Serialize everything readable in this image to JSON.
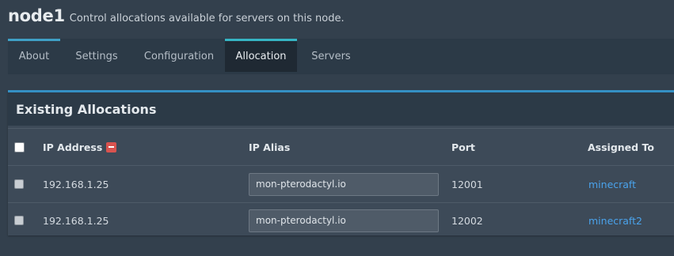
{
  "header": {
    "title": "node1",
    "subtitle": "Control allocations available for servers on this node."
  },
  "tabs": [
    {
      "label": "About"
    },
    {
      "label": "Settings"
    },
    {
      "label": "Configuration"
    },
    {
      "label": "Allocation",
      "active": true
    },
    {
      "label": "Servers"
    }
  ],
  "panel": {
    "title": "Existing Allocations",
    "columns": {
      "ip_address": "IP Address",
      "ip_alias": "IP Alias",
      "port": "Port",
      "assigned_to": "Assigned To"
    },
    "rows": [
      {
        "ip": "192.168.1.25",
        "alias": "mon-pterodactyl.io",
        "port": "12001",
        "assigned": "minecraft"
      },
      {
        "ip": "192.168.1.25",
        "alias": "mon-pterodactyl.io",
        "port": "12002",
        "assigned": "minecraft2"
      }
    ]
  },
  "colors": {
    "background": "#33404d",
    "accent": "#3490c4",
    "danger": "#d9534f",
    "link": "#4aa3ec"
  }
}
